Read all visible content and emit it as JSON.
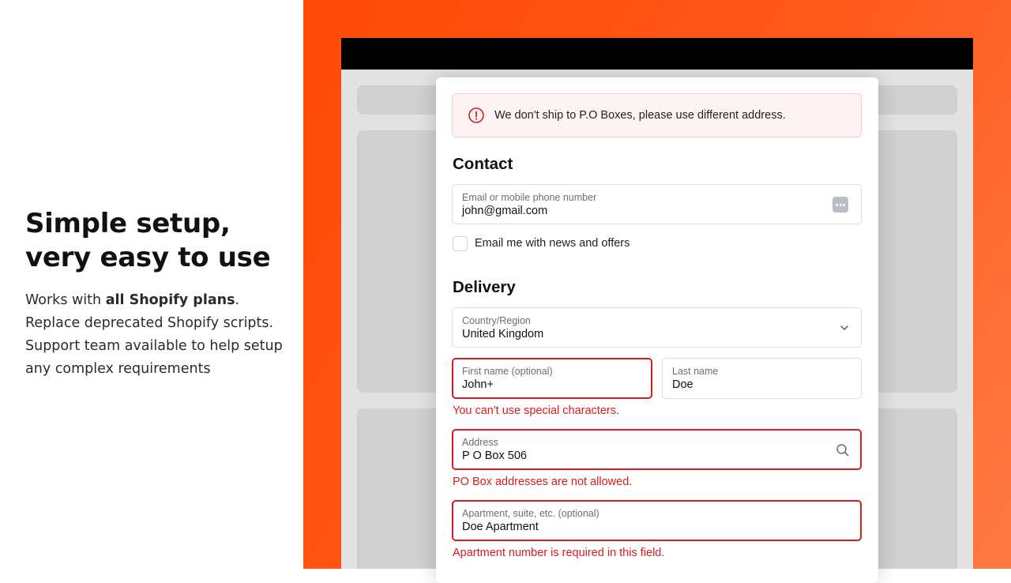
{
  "marketing": {
    "headline": "Simple setup, very easy to use",
    "line1_prefix": "Works with ",
    "line1_bold": "all Shopify plans",
    "line1_suffix": ".",
    "line2": "Replace deprecated Shopify scripts.",
    "line3": "Support team available to help setup any complex requirements"
  },
  "checkout": {
    "alert": {
      "icon": "alert-circle-icon",
      "message": "We don't ship to P.O Boxes, please use different address."
    },
    "contact": {
      "title": "Contact",
      "email_label": "Email or mobile phone number",
      "email_value": "john@gmail.com",
      "email_icon": "more-dots-icon",
      "newsletter_label": "Email me with news and offers",
      "newsletter_checked": false
    },
    "delivery": {
      "title": "Delivery",
      "country_label": "Country/Region",
      "country_value": "United Kingdom",
      "first_name_label": "First name (optional)",
      "first_name_value": "John+",
      "first_name_error": "You can't use special characters.",
      "last_name_label": "Last name",
      "last_name_value": "Doe",
      "address_label": "Address",
      "address_value": "P O Box 506",
      "address_error": "PO Box addresses are not allowed.",
      "apartment_label": "Apartment, suite, etc. (optional)",
      "apartment_value": "Doe Apartment",
      "apartment_error": "Apartment number is required in this field."
    }
  },
  "colors": {
    "accent_orange": "#ff4a06",
    "error_red": "#d91c1c",
    "alert_bg": "#fff4f4",
    "browser_bar": "#000000"
  }
}
